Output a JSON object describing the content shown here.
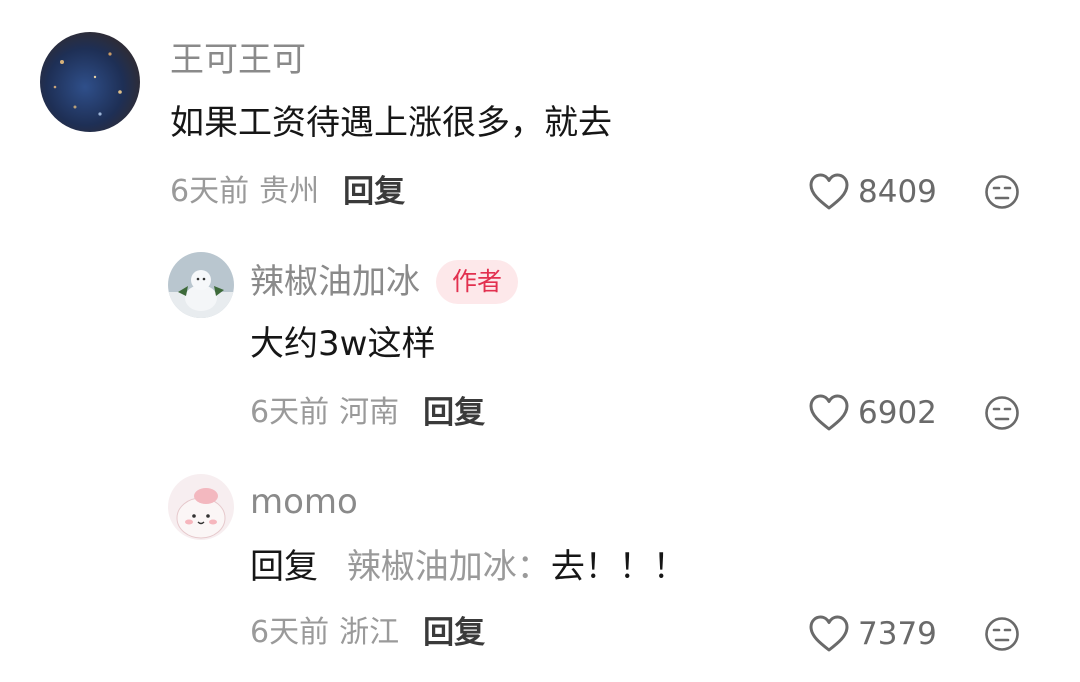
{
  "comments": [
    {
      "username": "王可王可",
      "text": "如果工资待遇上涨很多，就去",
      "time": "6天前",
      "location": "贵州",
      "reply_label": "回复",
      "likes": "8409"
    },
    {
      "username": "辣椒油加冰",
      "badge": "作者",
      "text": "大约3w这样",
      "time": "6天前",
      "location": "河南",
      "reply_label": "回复",
      "likes": "6902"
    },
    {
      "username": "momo",
      "reply_prefix": "回复",
      "reply_target": "辣椒油加冰：",
      "text": "去！！！",
      "time": "6天前",
      "location": "浙江",
      "reply_label": "回复",
      "likes": "7379"
    }
  ],
  "icons": {
    "like": "heart-outline-icon",
    "dislike": "expressionless-face-icon"
  },
  "colors": {
    "badge_bg": "#fde8ea",
    "badge_text": "#e2304f",
    "secondary_text": "#9a9a9a",
    "primary_text": "#161616"
  }
}
